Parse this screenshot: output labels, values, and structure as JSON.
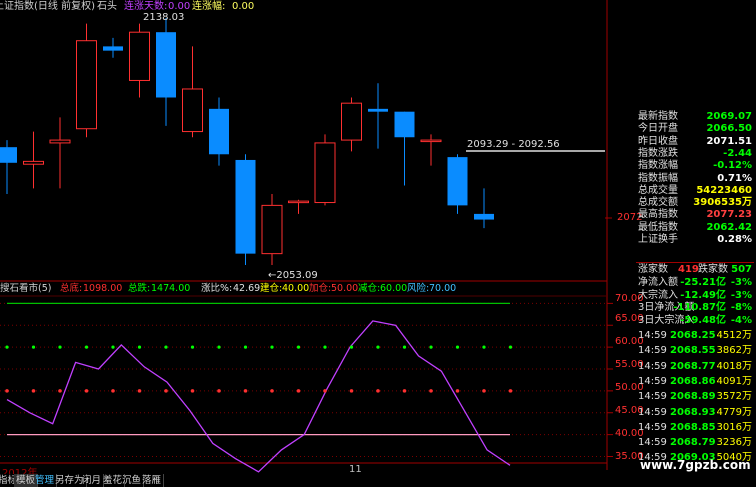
{
  "header": {
    "title": "上证指数(日线 前复权)",
    "stock": "石头",
    "streak_days_label": "连涨天数:",
    "streak_days_value": "0.00",
    "streak_amp_label": "连涨幅:",
    "streak_amp_value": "0.00"
  },
  "price_labels": {
    "high": "2138.03",
    "low": "←2053.09",
    "range": "2093.29 - 2092.56",
    "axis_2072": "2072"
  },
  "indicator": {
    "title": "搜石看市(5)",
    "total_buy_label": "总底:",
    "total_buy": "1098.00",
    "total_rise_label": "总跌:",
    "total_rise": "1474.00",
    "ratio_label": "涨比%:",
    "ratio": "42.69",
    "build_label": "建仓:",
    "build": "40.00",
    "add_label": "加仓:",
    "add": "50.00",
    "reduce_label": "减仓:",
    "reduce": "60.00",
    "risk_label": "风险:",
    "risk": "70.00",
    "axis": [
      "70.00",
      "65.00",
      "60.00",
      "55.00",
      "50.00",
      "45.00",
      "40.00",
      "35.00"
    ]
  },
  "candles": [
    {
      "o": 2094.5,
      "c": 2089.0,
      "h": 2097.0,
      "l": 2078.0
    },
    {
      "o": 2088.5,
      "c": 2089.5,
      "h": 2100.0,
      "l": 2080.0
    },
    {
      "o": 2096.0,
      "c": 2097.0,
      "h": 2105.0,
      "l": 2080.0
    },
    {
      "o": 2101.0,
      "c": 2132.0,
      "h": 2138.0,
      "l": 2098.0
    },
    {
      "o": 2130.0,
      "c": 2128.5,
      "h": 2133.0,
      "l": 2126.0
    },
    {
      "o": 2118.0,
      "c": 2135.0,
      "h": 2138.0,
      "l": 2112.0
    },
    {
      "o": 2135.0,
      "c": 2112.0,
      "h": 2140.0,
      "l": 2102.0
    },
    {
      "o": 2100.0,
      "c": 2115.0,
      "h": 2130.0,
      "l": 2098.0
    },
    {
      "o": 2108.0,
      "c": 2092.0,
      "h": 2112.0,
      "l": 2088.0
    },
    {
      "o": 2090.0,
      "c": 2057.0,
      "h": 2092.0,
      "l": 2053.0
    },
    {
      "o": 2057.0,
      "c": 2074.0,
      "h": 2078.0,
      "l": 2053.0
    },
    {
      "o": 2075.0,
      "c": 2075.5,
      "h": 2076.0,
      "l": 2071.0
    },
    {
      "o": 2075.0,
      "c": 2096.0,
      "h": 2099.0,
      "l": 2074.0
    },
    {
      "o": 2097.0,
      "c": 2110.0,
      "h": 2112.0,
      "l": 2093.0
    },
    {
      "o": 2108.0,
      "c": 2107.0,
      "h": 2117.0,
      "l": 2094.0
    },
    {
      "o": 2107.0,
      "c": 2098.0,
      "h": 2107.0,
      "l": 2081.0
    },
    {
      "o": 2097.0,
      "c": 2097.0,
      "h": 2099.0,
      "l": 2088.0
    },
    {
      "o": 2091.0,
      "c": 2074.0,
      "h": 2092.0,
      "l": 2071.0
    },
    {
      "o": 2071.0,
      "c": 2069.0,
      "h": 2080.0,
      "l": 2066.0
    }
  ],
  "indicator_series": [
    48.0,
    45.0,
    42.5,
    56.5,
    55.0,
    60.5,
    55.5,
    52.0,
    45.5,
    38.0,
    34.5,
    31.5,
    36.5,
    40.0,
    50.5,
    60.0,
    66.0,
    65.0,
    58.0,
    54.5,
    45.5,
    36.5,
    33.0
  ],
  "info_panel": {
    "rows": [
      {
        "label": "最新指数",
        "value": "2069.07",
        "color": "#00ff00"
      },
      {
        "label": "今日开盘",
        "value": "2066.50",
        "color": "#00ff00"
      },
      {
        "label": "昨日收盘",
        "value": "2071.51",
        "color": "#ffffff"
      },
      {
        "label": "指数涨跌",
        "value": "-2.44",
        "color": "#00ff00"
      },
      {
        "label": "指数涨幅",
        "value": "-0.12%",
        "color": "#00ff00"
      },
      {
        "label": "指数振幅",
        "value": "0.71%",
        "color": "#ffffff"
      },
      {
        "label": "总成交量",
        "value": "54223460",
        "color": "#ffff00"
      },
      {
        "label": "总成交额",
        "value": "3906535万",
        "color": "#ffff00"
      },
      {
        "label": "最高指数",
        "value": "2077.23",
        "color": "#ff4040"
      },
      {
        "label": "最低指数",
        "value": "2062.42",
        "color": "#00ff00"
      },
      {
        "label": "上证换手",
        "value": "0.28%",
        "color": "#ffffff"
      }
    ],
    "up_label": "涨家数",
    "up_value": "419",
    "down_label": "跌家数",
    "down_value": "507",
    "flows": [
      {
        "label": "净流入额",
        "value": "-25.21亿",
        "pct": "-3%"
      },
      {
        "label": "大宗流入",
        "value": "-12.49亿",
        "pct": "-3%"
      },
      {
        "label": "3日净流入额",
        "value": "-110.87亿",
        "pct": "-8%"
      },
      {
        "label": "3日大宗流入",
        "value": "-59.48亿",
        "pct": "-4%"
      }
    ],
    "ticks": [
      {
        "time": "14:59",
        "price": "2068.25",
        "vol": "4512万"
      },
      {
        "time": "14:59",
        "price": "2068.55",
        "vol": "3862万"
      },
      {
        "time": "14:59",
        "price": "2068.77",
        "vol": "4018万"
      },
      {
        "time": "14:59",
        "price": "2068.86",
        "vol": "4091万"
      },
      {
        "time": "14:59",
        "price": "2068.89",
        "vol": "3572万"
      },
      {
        "time": "14:59",
        "price": "2068.93",
        "vol": "4779万"
      },
      {
        "time": "14:59",
        "price": "2068.85",
        "vol": "3016万"
      },
      {
        "time": "14:59",
        "price": "2068.79",
        "vol": "3236万"
      },
      {
        "time": "14:59",
        "price": "2069.03",
        "vol": "5040万"
      }
    ]
  },
  "time_axis": {
    "year": "2012年",
    "month": "11"
  },
  "watermark": "www.7gpzb.com",
  "bottom_tabs": [
    "指标",
    "模板",
    "管理",
    "另存为",
    "闭月",
    "羞花",
    "沉鱼",
    "落雁"
  ],
  "colors": {
    "up": "#ff3030",
    "down": "#0a8cff",
    "purple": "#c040ff"
  }
}
